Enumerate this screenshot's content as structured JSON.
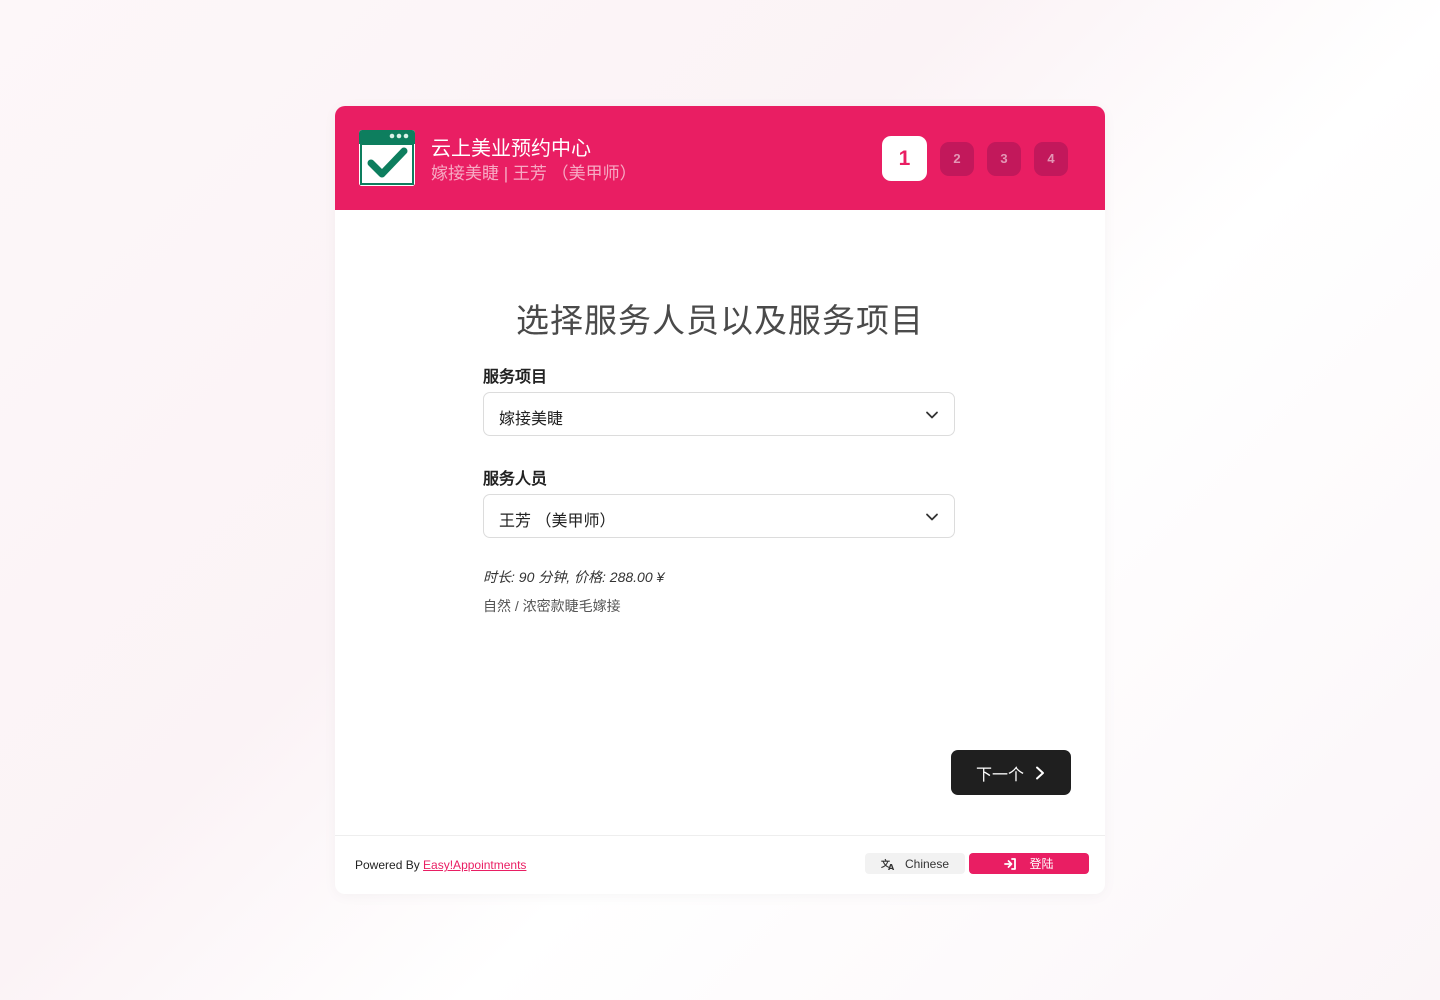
{
  "header": {
    "company_name": "云上美业预约中心",
    "subtitle": "嫁接美睫 | 王芳 （美甲师）",
    "logo_icon": "calendar-check-icon",
    "steps": [
      "1",
      "2",
      "3",
      "4"
    ],
    "active_step": "1"
  },
  "main": {
    "title": "选择服务人员以及服务项目",
    "service": {
      "label": "服务项目",
      "value": "嫁接美睫"
    },
    "provider": {
      "label": "服务人员",
      "value": "王芳 （美甲师）"
    },
    "meta": "时长: 90 分钟, 价格: 288.00 ¥",
    "description": "自然 / 浓密款睫毛嫁接",
    "next_label": "下一个"
  },
  "footer": {
    "powered_prefix": "Powered By",
    "powered_link": "Easy!Appointments",
    "language_label": "Chinese",
    "login_label": "登陆"
  },
  "colors": {
    "brand": "#e91e63",
    "brand_dark": "#c2185b",
    "button_dark": "#1f1f1f"
  }
}
